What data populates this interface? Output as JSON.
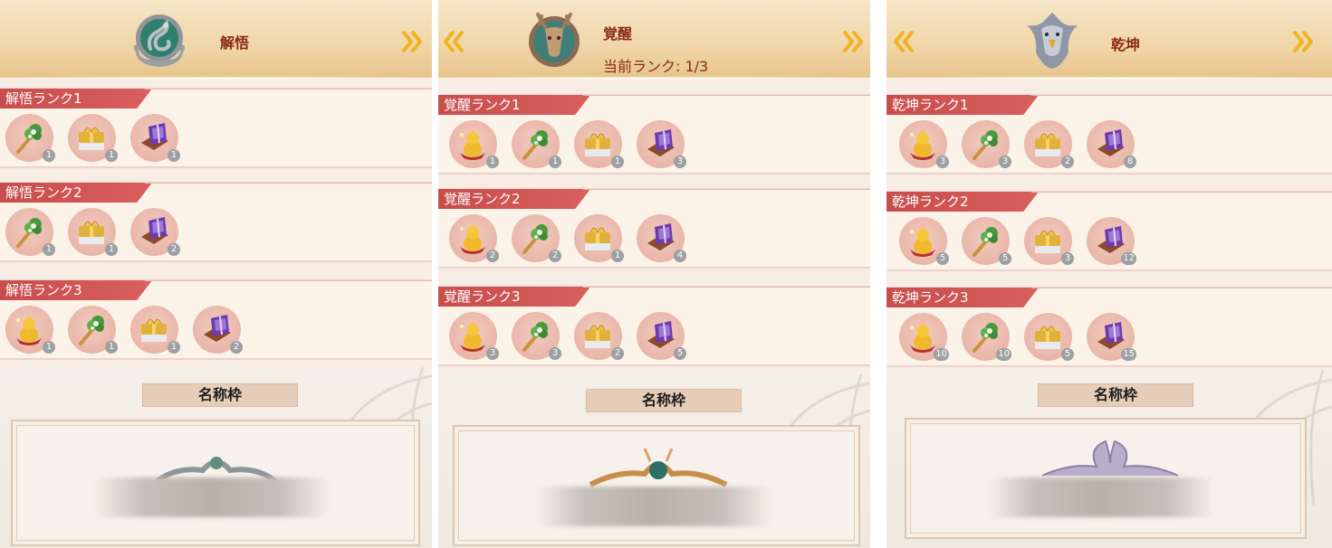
{
  "panels": [
    {
      "title": "解悟",
      "subtitle": "",
      "has_left_arrow": false,
      "has_right_arrow": true,
      "emblem_icon": "serpent-emblem-icon",
      "ranks": [
        {
          "label": "解悟ランク1",
          "items": [
            {
              "icon": "herb-icon",
              "count": "1"
            },
            {
              "icon": "gift-box-icon",
              "count": "1"
            },
            {
              "icon": "purple-book-icon",
              "count": "1"
            }
          ]
        },
        {
          "label": "解悟ランク2",
          "items": [
            {
              "icon": "herb-icon",
              "count": "1"
            },
            {
              "icon": "gift-box-icon",
              "count": "1"
            },
            {
              "icon": "purple-book-icon",
              "count": "2"
            }
          ]
        },
        {
          "label": "解悟ランク3",
          "items": [
            {
              "icon": "golden-figure-icon",
              "count": "1"
            },
            {
              "icon": "herb-icon",
              "count": "1"
            },
            {
              "icon": "gift-box-icon",
              "count": "1"
            },
            {
              "icon": "purple-book-icon",
              "count": "2"
            }
          ]
        }
      ],
      "frame_label": "名称枠"
    },
    {
      "title": "覚醒",
      "subtitle": "当前ランク: 1/3",
      "has_left_arrow": true,
      "has_right_arrow": true,
      "emblem_icon": "deer-emblem-icon",
      "ranks": [
        {
          "label": "覚醒ランク1",
          "items": [
            {
              "icon": "golden-figure-icon",
              "count": "1"
            },
            {
              "icon": "herb-icon",
              "count": "1"
            },
            {
              "icon": "gift-box-icon",
              "count": "1"
            },
            {
              "icon": "purple-book-icon",
              "count": "3"
            }
          ]
        },
        {
          "label": "覚醒ランク2",
          "items": [
            {
              "icon": "golden-figure-icon",
              "count": "2"
            },
            {
              "icon": "herb-icon",
              "count": "2"
            },
            {
              "icon": "gift-box-icon",
              "count": "1"
            },
            {
              "icon": "purple-book-icon",
              "count": "4"
            }
          ]
        },
        {
          "label": "覚醒ランク3",
          "items": [
            {
              "icon": "golden-figure-icon",
              "count": "3"
            },
            {
              "icon": "herb-icon",
              "count": "3"
            },
            {
              "icon": "gift-box-icon",
              "count": "2"
            },
            {
              "icon": "purple-book-icon",
              "count": "5"
            }
          ]
        }
      ],
      "frame_label": "名称枠"
    },
    {
      "title": "乾坤",
      "subtitle": "",
      "has_left_arrow": true,
      "has_right_arrow": true,
      "emblem_icon": "eagle-emblem-icon",
      "ranks": [
        {
          "label": "乾坤ランク1",
          "items": [
            {
              "icon": "golden-figure-icon",
              "count": "3"
            },
            {
              "icon": "herb-icon",
              "count": "3"
            },
            {
              "icon": "gift-box-icon",
              "count": "2"
            },
            {
              "icon": "purple-book-icon",
              "count": "8"
            }
          ]
        },
        {
          "label": "乾坤ランク2",
          "items": [
            {
              "icon": "golden-figure-icon",
              "count": "5"
            },
            {
              "icon": "herb-icon",
              "count": "5"
            },
            {
              "icon": "gift-box-icon",
              "count": "3"
            },
            {
              "icon": "purple-book-icon",
              "count": "12"
            }
          ]
        },
        {
          "label": "乾坤ランク3",
          "items": [
            {
              "icon": "golden-figure-icon",
              "count": "10"
            },
            {
              "icon": "herb-icon",
              "count": "10"
            },
            {
              "icon": "gift-box-icon",
              "count": "5"
            },
            {
              "icon": "purple-book-icon",
              "count": "15"
            }
          ]
        }
      ],
      "frame_label": "名称枠"
    }
  ],
  "colors": {
    "title_red": "#8a2c12",
    "rank_tab_red": "#cc5252",
    "item_circle": "#ebb9ad",
    "count_badge": "#9c9fa3",
    "arrow_gold": "#f2b321"
  }
}
